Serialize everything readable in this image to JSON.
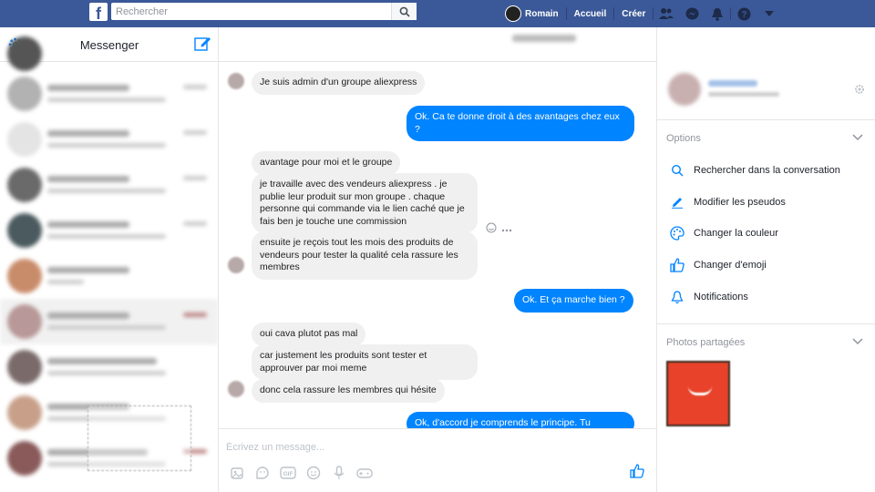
{
  "topbar": {
    "logo": "f",
    "search_placeholder": "Rechercher",
    "user_name": "Romain",
    "home_label": "Accueil",
    "create_label": "Créer"
  },
  "sidebar": {
    "title": "Messenger"
  },
  "conversation": {
    "messages": [
      {
        "dir": "in",
        "text": "Je suis admin d'un groupe aliexpress"
      },
      {
        "dir": "out",
        "text": "Ok. Ca te donne droit à des avantages chez eux ?"
      },
      {
        "dir": "in",
        "text": "avantage pour moi et le groupe"
      },
      {
        "dir": "in",
        "text": "je travaille avec des vendeurs aliexpress . je publie leur produit sur mon groupe . chaque personne qui commande via le lien caché que je fais ben je touche une commission"
      },
      {
        "dir": "in",
        "text": "ensuite je reçois tout les mois des produits de vendeurs pour tester la qualité cela rassure les membres"
      },
      {
        "dir": "out",
        "text": "Ok. Et ça marche bien ?"
      },
      {
        "dir": "in",
        "text": "oui cava plutot pas mal"
      },
      {
        "dir": "in",
        "text": "car justement les produits sont tester et approuver par moi meme"
      },
      {
        "dir": "in",
        "text": "donc cela rassure les membres qui hésite"
      },
      {
        "dir": "out",
        "text": "Ok, d'accord je comprends le principe. Tu"
      }
    ],
    "composer_placeholder": "Écrivez un message..."
  },
  "details": {
    "options_title": "Options",
    "options": [
      {
        "icon": "search-icon",
        "label": "Rechercher dans la conversation"
      },
      {
        "icon": "pencil-icon",
        "label": "Modifier les pseudos"
      },
      {
        "icon": "palette-icon",
        "label": "Changer la couleur"
      },
      {
        "icon": "thumbs-up-icon",
        "label": "Changer d'emoji"
      },
      {
        "icon": "bell-icon",
        "label": "Notifications"
      }
    ],
    "photos_title": "Photos partagées"
  },
  "colors": {
    "brand": "#3b5998",
    "messenger_blue": "#0084ff",
    "incoming_bubble": "#f1f0f0",
    "call_badge": "#e41e3f"
  }
}
